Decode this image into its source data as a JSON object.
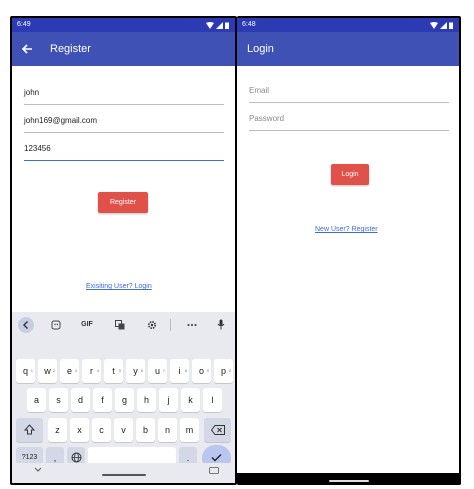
{
  "register": {
    "status_time": "6:49",
    "title": "Register",
    "fields": [
      {
        "value": "john"
      },
      {
        "value": "john169@gmail.com"
      },
      {
        "value": "123456"
      }
    ],
    "button_label": "Register",
    "link_text": "Exisiting User? Login"
  },
  "keyboard": {
    "toolbar": {
      "gif": "GIF"
    },
    "row1": [
      {
        "k": "q",
        "h": "1"
      },
      {
        "k": "w",
        "h": "2"
      },
      {
        "k": "e",
        "h": "3"
      },
      {
        "k": "r",
        "h": "4"
      },
      {
        "k": "t",
        "h": "5"
      },
      {
        "k": "y",
        "h": "6"
      },
      {
        "k": "u",
        "h": "7"
      },
      {
        "k": "i",
        "h": "8"
      },
      {
        "k": "o",
        "h": "9"
      },
      {
        "k": "p",
        "h": "0"
      }
    ],
    "row2": [
      "a",
      "s",
      "d",
      "f",
      "g",
      "h",
      "j",
      "k",
      "l"
    ],
    "row3": [
      "z",
      "x",
      "c",
      "v",
      "b",
      "n",
      "m"
    ],
    "sym_label": "?123",
    "comma": ",",
    "period": "."
  },
  "login": {
    "status_time": "6:48",
    "title": "Login",
    "email_placeholder": "Email",
    "password_placeholder": "Password",
    "button_label": "Login",
    "link_text": "New User? Register"
  },
  "colors": {
    "appbar": "#3f51b5",
    "statusbar": "#2c3bb4",
    "button": "#e0514a",
    "link": "#3f6dd6"
  }
}
